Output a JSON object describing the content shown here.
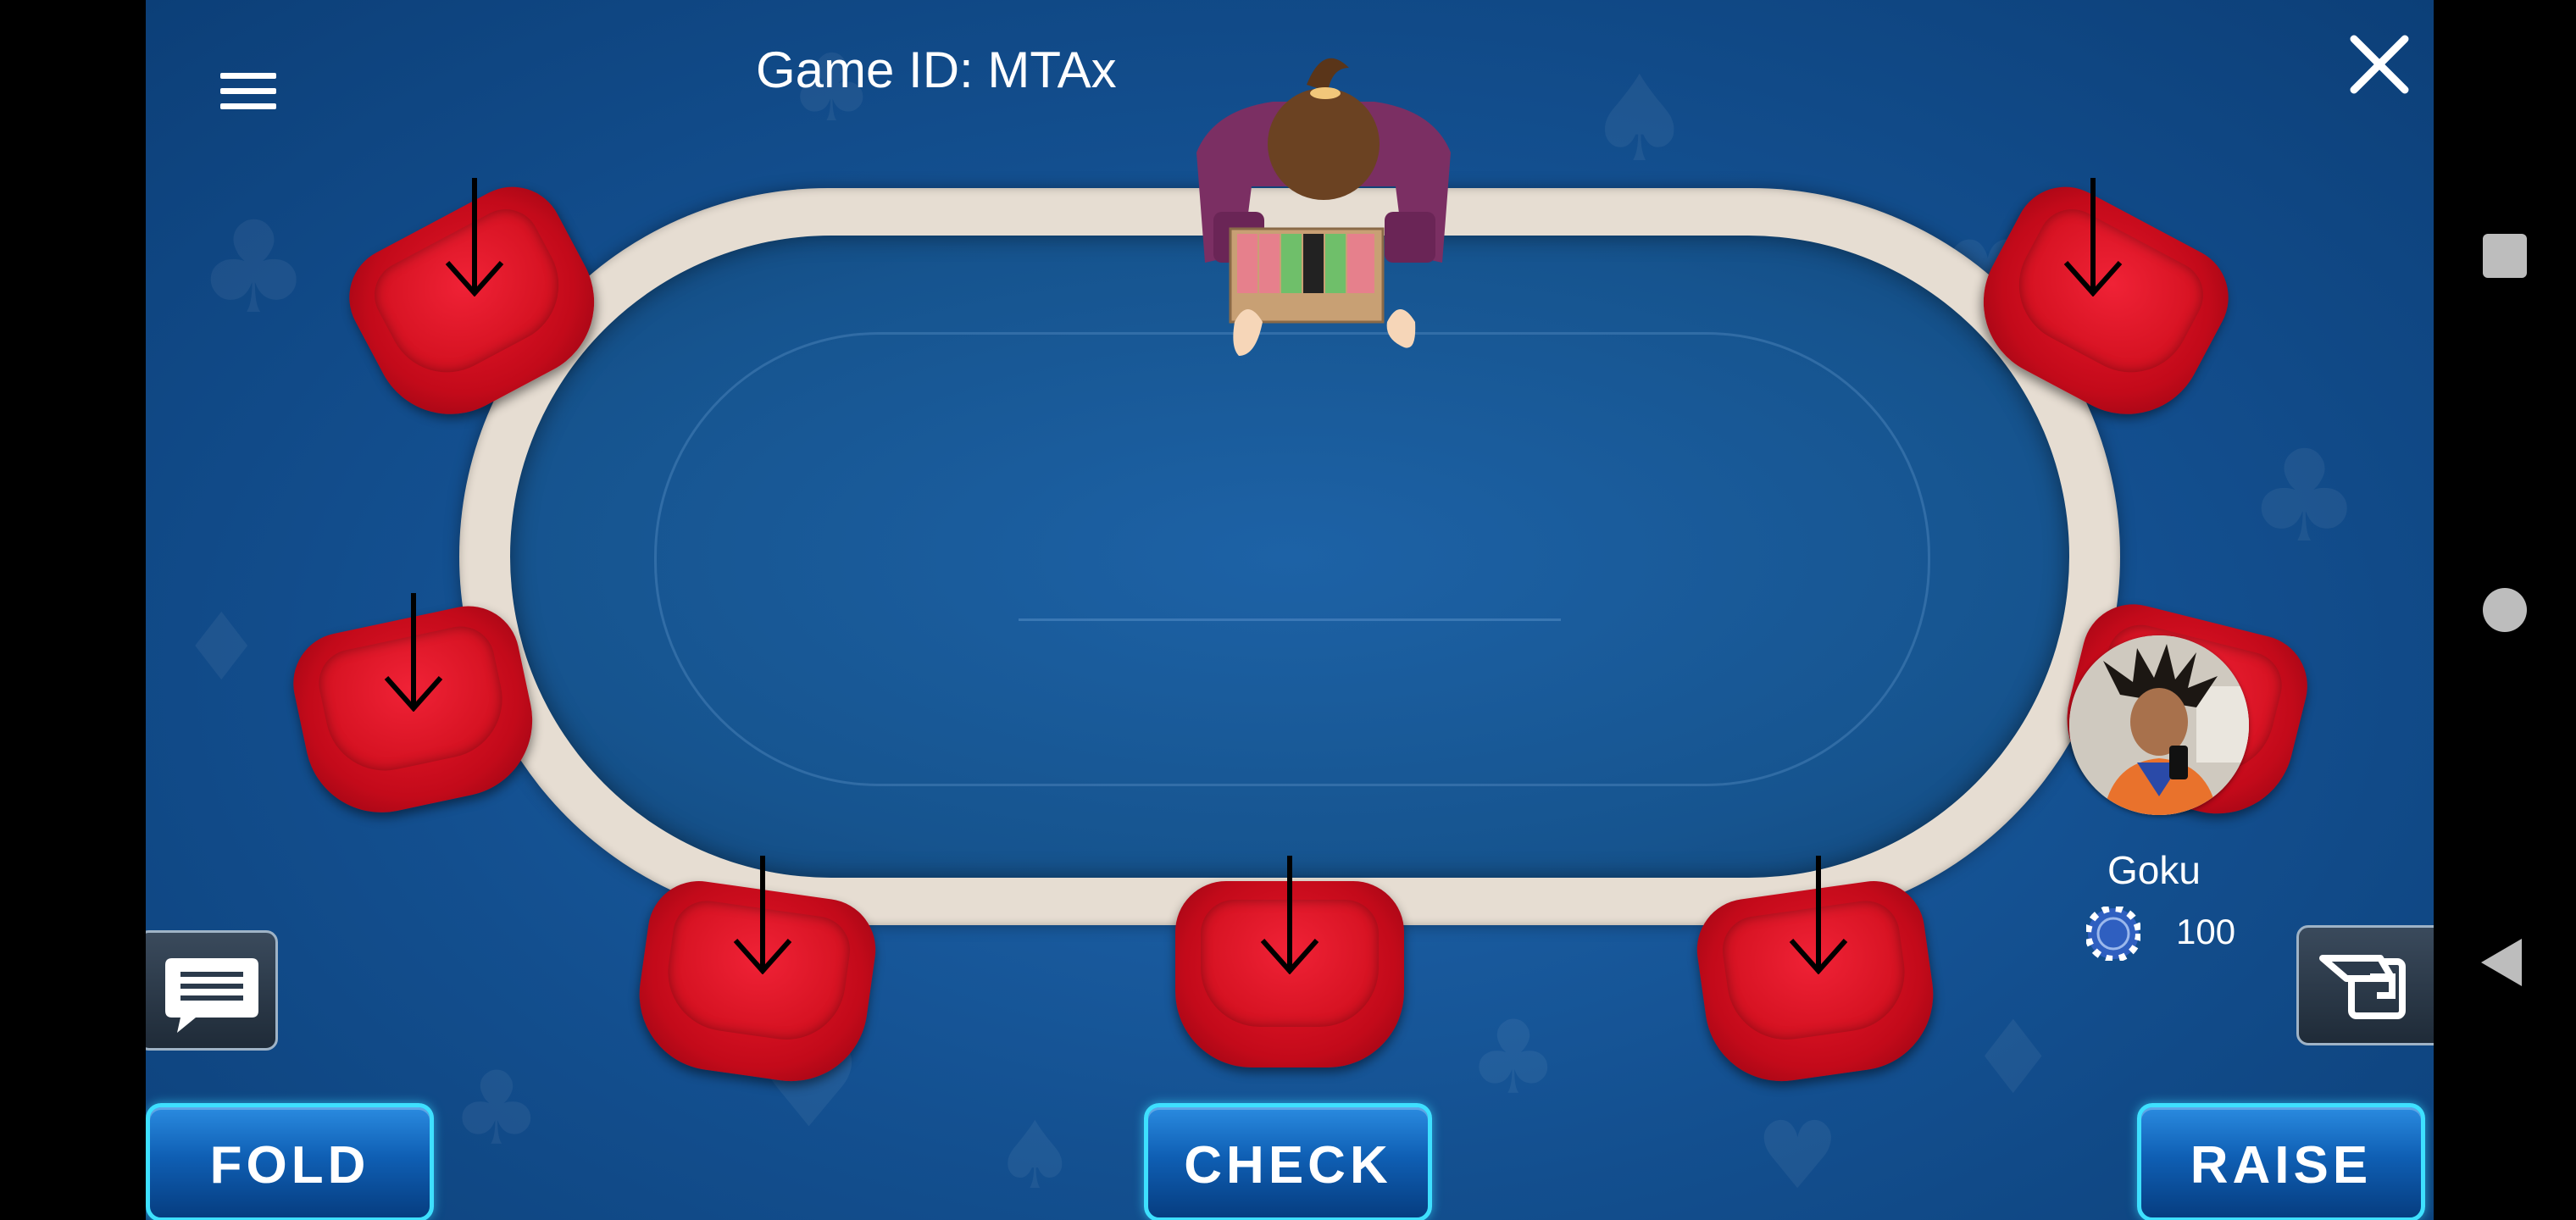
{
  "header": {
    "game_id": "Game ID: MTAx"
  },
  "player": {
    "name": "Goku",
    "chips": "100"
  },
  "actions": {
    "fold": "FOLD",
    "check": "CHECK",
    "raise": "RAISE"
  },
  "seats": [
    {
      "id": "seat-1",
      "state": "empty"
    },
    {
      "id": "seat-2",
      "state": "empty"
    },
    {
      "id": "seat-3",
      "state": "empty"
    },
    {
      "id": "seat-4",
      "state": "empty"
    },
    {
      "id": "seat-5",
      "state": "empty"
    },
    {
      "id": "seat-6",
      "state": "empty"
    },
    {
      "id": "seat-7",
      "state": "occupied"
    }
  ],
  "icons": {
    "menu": "hamburger-icon",
    "close": "close-icon",
    "chat": "chat-icon",
    "cashier": "cashier-icon",
    "chip": "poker-chip-icon",
    "seat_arrow": "arrow-down-icon"
  },
  "colors": {
    "felt": "#16548f",
    "rim": "#e6ddd2",
    "chair": "#d2101f",
    "button_glow": "#3ee0ff"
  }
}
